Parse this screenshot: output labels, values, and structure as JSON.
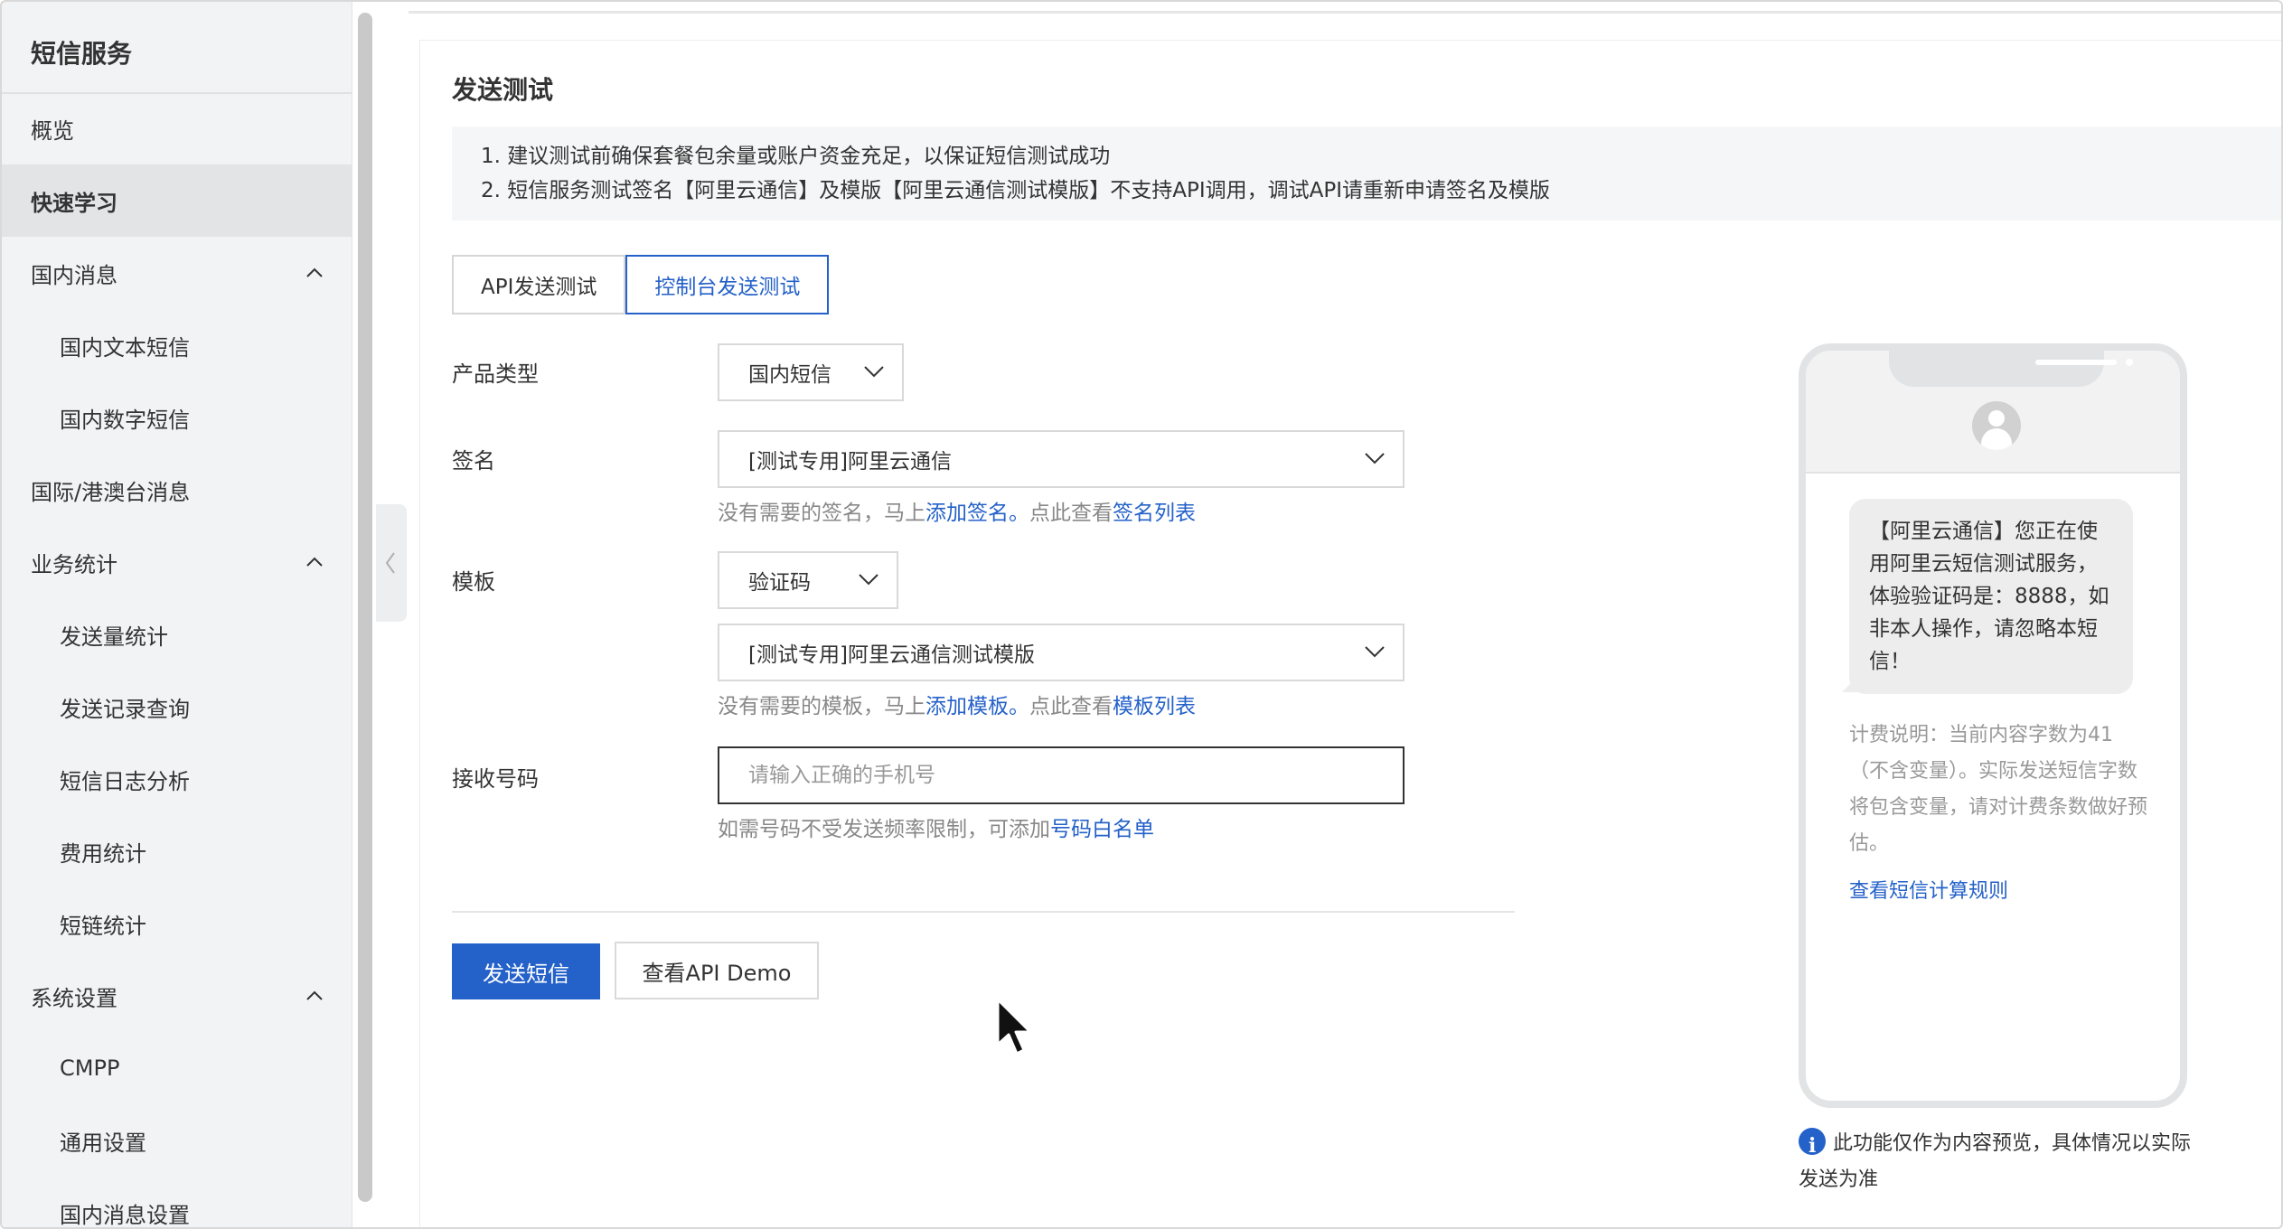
{
  "sidebar": {
    "title": "短信服务",
    "items": [
      {
        "label": "概览"
      },
      {
        "label": "快速学习"
      },
      {
        "label": "国内消息"
      },
      {
        "label": "国内文本短信"
      },
      {
        "label": "国内数字短信"
      },
      {
        "label": "国际/港澳台消息"
      },
      {
        "label": "业务统计"
      },
      {
        "label": "发送量统计"
      },
      {
        "label": "发送记录查询"
      },
      {
        "label": "短信日志分析"
      },
      {
        "label": "费用统计"
      },
      {
        "label": "短链统计"
      },
      {
        "label": "系统设置"
      },
      {
        "label": "CMPP"
      },
      {
        "label": "通用设置"
      },
      {
        "label": "国内消息设置"
      }
    ]
  },
  "page": {
    "title": "发送测试",
    "notice": [
      "1. 建议测试前确保套餐包余量或账户资金充足，以保证短信测试成功",
      "2. 短信服务测试签名【阿里云通信】及模版【阿里云通信测试模版】不支持API调用，调试API请重新申请签名及模版"
    ],
    "tabs": [
      "API发送测试",
      "控制台发送测试"
    ]
  },
  "form": {
    "product_label": "产品类型",
    "product_value": "国内短信",
    "sign_label": "签名",
    "sign_value": "[测试专用]阿里云通信",
    "sign_help_pre": "没有需要的签名，马上",
    "sign_help_link1": "添加签名。",
    "sign_help_mid": "点此查看",
    "sign_help_link2": "签名列表",
    "template_label": "模板",
    "template_type_value": "验证码",
    "template_value": "[测试专用]阿里云通信测试模版",
    "template_help_pre": "没有需要的模板，马上",
    "template_help_link1": "添加模板。",
    "template_help_mid": "点此查看",
    "template_help_link2": "模板列表",
    "phone_label": "接收号码",
    "phone_placeholder": "请输入正确的手机号",
    "phone_help_pre": "如需号码不受发送频率限制，可添加",
    "phone_help_link": "号码白名单",
    "send_button": "发送短信",
    "demo_button": "查看API Demo"
  },
  "preview": {
    "message": "【阿里云通信】您正在使用阿里云短信测试服务，体验验证码是：8888，如非本人操作，请忽略本短信！",
    "billing": "计费说明：当前内容字数为41（不含变量）。实际发送短信字数将包含变量，请对计费条数做好预估。",
    "rule_link": "查看短信计算规则",
    "note": "此功能仅作为内容预览，具体情况以实际发送为准"
  },
  "colors": {
    "accent": "#2461c9",
    "brand": "#ff6a00"
  }
}
